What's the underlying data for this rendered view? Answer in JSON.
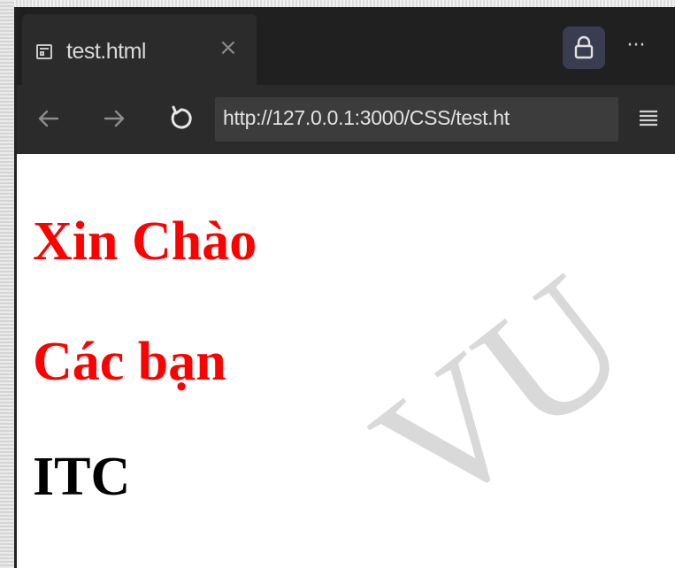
{
  "browser": {
    "tab": {
      "title": "test.html",
      "icon": "document-page-icon",
      "close_label": "×"
    },
    "toolbar": {
      "lock_icon": "lock-icon",
      "more_label": "···"
    },
    "nav": {
      "back_icon": "arrow-left-icon",
      "forward_icon": "arrow-right-icon",
      "reload_icon": "reload-icon",
      "url": "http://127.0.0.1:3000/CSS/test.ht",
      "menu_icon": "hamburger-menu-icon"
    }
  },
  "page": {
    "headings": [
      {
        "text": "Xin Chào",
        "color": "#ff0000"
      },
      {
        "text": "Các bạn",
        "color": "#ff0000"
      },
      {
        "text": "ITC",
        "color": "#000000"
      }
    ],
    "watermark": "VU"
  },
  "colors": {
    "tabbar_bg": "#202020",
    "navbar_bg": "#2b2b2b",
    "address_bg": "#3c3c3c",
    "lock_button_bg": "#3a3d50"
  }
}
